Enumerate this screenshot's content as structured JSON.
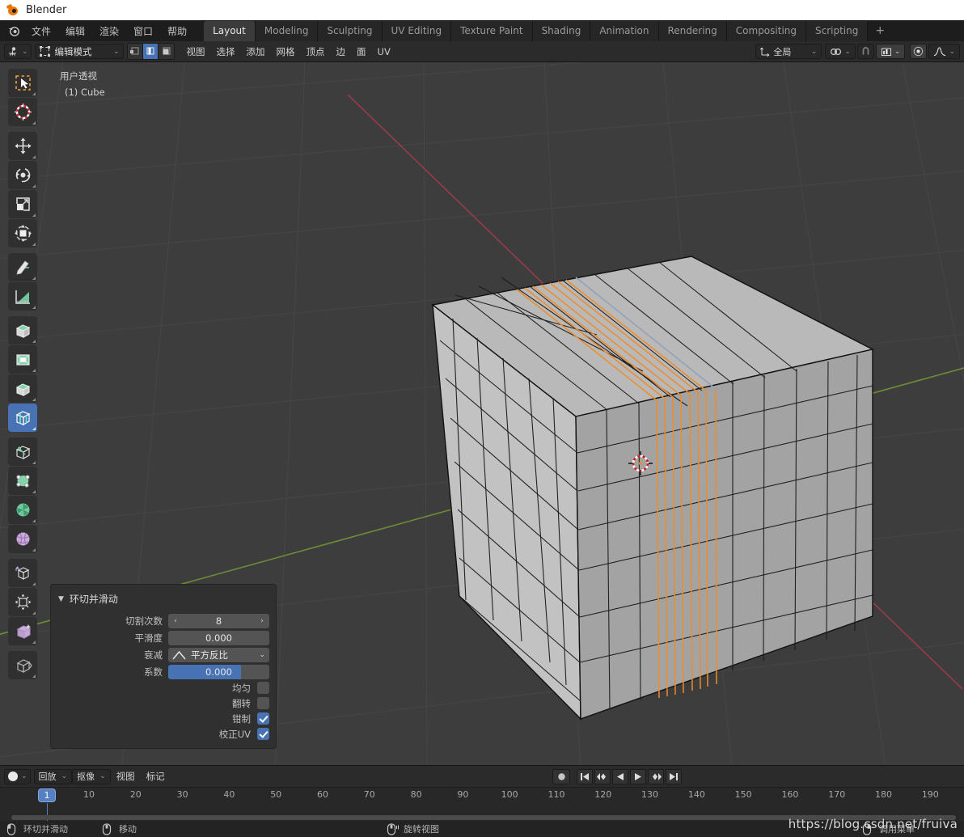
{
  "window": {
    "title": "Blender"
  },
  "topbar": {
    "menus": [
      "文件",
      "编辑",
      "渲染",
      "窗口",
      "帮助"
    ],
    "workspaces": [
      {
        "label": "Layout",
        "active": true
      },
      {
        "label": "Modeling",
        "active": false
      },
      {
        "label": "Sculpting",
        "active": false
      },
      {
        "label": "UV Editing",
        "active": false
      },
      {
        "label": "Texture Paint",
        "active": false
      },
      {
        "label": "Shading",
        "active": false
      },
      {
        "label": "Animation",
        "active": false
      },
      {
        "label": "Rendering",
        "active": false
      },
      {
        "label": "Compositing",
        "active": false
      },
      {
        "label": "Scripting",
        "active": false
      }
    ],
    "add_workspace": "+"
  },
  "viewport_header": {
    "editor_type_icon": "editor-3d-viewport-icon",
    "mode": "编辑模式",
    "select_modes": [
      {
        "name": "vertex-select",
        "active": false
      },
      {
        "name": "edge-select",
        "active": true
      },
      {
        "name": "face-select",
        "active": false
      }
    ],
    "menus": [
      "视图",
      "选择",
      "添加",
      "网格",
      "顶点",
      "边",
      "面",
      "UV"
    ],
    "transform_orientation": "全局",
    "snap_icon": "magnet-icon",
    "snap_target_icon": "snap-increment-icon",
    "proportional_icon": "proportional-editing-icon",
    "falloff_icon": "smooth-falloff-icon"
  },
  "viewport": {
    "perspective_label": "用户透视",
    "object_label": "(1) Cube",
    "background_color": "#3d3d3d",
    "select_color": "#f08c28",
    "tools": [
      {
        "name": "tweak-select-tool",
        "icon": "cursor-arrow-icon",
        "active": false
      },
      {
        "name": "cursor-tool",
        "icon": "3d-cursor-icon",
        "active": false
      },
      {
        "name": "move-tool",
        "icon": "move-arrows-icon",
        "active": false
      },
      {
        "name": "rotate-tool",
        "icon": "rotate-icon",
        "active": false
      },
      {
        "name": "scale-tool",
        "icon": "scale-icon",
        "active": false
      },
      {
        "name": "transform-tool",
        "icon": "transform-icon",
        "active": false
      },
      {
        "name": "annotate-tool",
        "icon": "pencil-icon",
        "active": false
      },
      {
        "name": "measure-tool",
        "icon": "ruler-icon",
        "active": false
      },
      {
        "name": "extrude-region-tool",
        "icon": "extrude-cube-icon",
        "active": false
      },
      {
        "name": "inset-faces-tool",
        "icon": "inset-cube-icon",
        "active": false
      },
      {
        "name": "bevel-tool",
        "icon": "bevel-cube-icon",
        "active": false
      },
      {
        "name": "loop-cut-tool",
        "icon": "loop-cut-icon",
        "active": true
      },
      {
        "name": "knife-tool",
        "icon": "knife-icon",
        "active": false
      },
      {
        "name": "poly-build-tool",
        "icon": "poly-build-icon",
        "active": false
      },
      {
        "name": "spin-tool",
        "icon": "spin-icon",
        "active": false
      },
      {
        "name": "smooth-tool",
        "icon": "smooth-sphere-icon",
        "active": false
      },
      {
        "name": "edge-slide-tool",
        "icon": "edge-slide-icon",
        "active": false
      },
      {
        "name": "shrink-fatten-tool",
        "icon": "shrink-fatten-icon",
        "active": false
      },
      {
        "name": "shear-tool",
        "icon": "shear-icon",
        "active": false
      },
      {
        "name": "rip-region-tool",
        "icon": "rip-region-icon",
        "active": false
      }
    ]
  },
  "operator_panel": {
    "title": "环切并滑动",
    "collapse_icon": "triangle-down-icon",
    "fields": [
      {
        "label": "切割次数",
        "value": "8",
        "type": "stepper"
      },
      {
        "label": "平滑度",
        "value": "0.000",
        "type": "number"
      },
      {
        "label": "衰减",
        "value": "平方反比",
        "type": "dropdown",
        "icon": "falloff-curve-icon"
      },
      {
        "label": "系数",
        "value": "0.000",
        "type": "slider",
        "fill_pct": 72
      }
    ],
    "checkboxes": [
      {
        "label": "均匀",
        "checked": false
      },
      {
        "label": "翻转",
        "checked": false
      },
      {
        "label": "钳制",
        "checked": true
      },
      {
        "label": "校正UV",
        "checked": true
      }
    ]
  },
  "timeline": {
    "editor_type_icon": "editor-timeline-icon",
    "menus": [
      "回放",
      "抠像",
      "视图",
      "标记"
    ],
    "menu_has_arrow": [
      true,
      true,
      false,
      false
    ],
    "current_frame": "1",
    "ticks": [
      10,
      20,
      30,
      40,
      50,
      60,
      70,
      80,
      90,
      100,
      110,
      120,
      130,
      140,
      150,
      160,
      170,
      180,
      190
    ],
    "playback_buttons": [
      {
        "name": "record-button",
        "icon": "record-dot-icon"
      },
      {
        "name": "jump-to-start-button",
        "icon": "skip-start-icon"
      },
      {
        "name": "prev-keyframe-button",
        "icon": "prev-keyframe-icon"
      },
      {
        "name": "play-reverse-button",
        "icon": "play-reverse-icon"
      },
      {
        "name": "play-button",
        "icon": "play-icon"
      },
      {
        "name": "next-keyframe-button",
        "icon": "next-keyframe-icon"
      },
      {
        "name": "jump-to-end-button",
        "icon": "skip-end-icon"
      }
    ]
  },
  "statusbar": {
    "items": [
      {
        "icon": "mouse-left-icon",
        "label": "环切并滑动"
      },
      {
        "icon": "mouse-middle-icon",
        "label": "移动"
      },
      {
        "icon": "mouse-middle-drag-icon",
        "label": "旋转视图"
      },
      {
        "icon": "mouse-right-icon",
        "label": "调用菜单"
      }
    ]
  },
  "watermark": {
    "text": "https://blog.csdn.net/fruiva"
  }
}
